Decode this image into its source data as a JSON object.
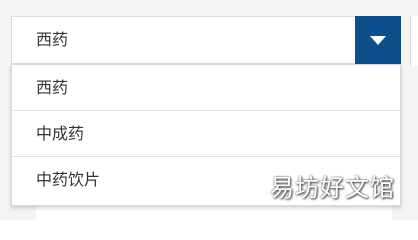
{
  "select": {
    "value": "西药",
    "toggle_icon": "caret-down-icon",
    "accent_color": "#0d4f8c"
  },
  "dropdown": {
    "options": [
      {
        "label": "西药"
      },
      {
        "label": "中成药"
      },
      {
        "label": "中药饮片"
      }
    ]
  },
  "watermark": {
    "text": "易坊好文馆"
  }
}
